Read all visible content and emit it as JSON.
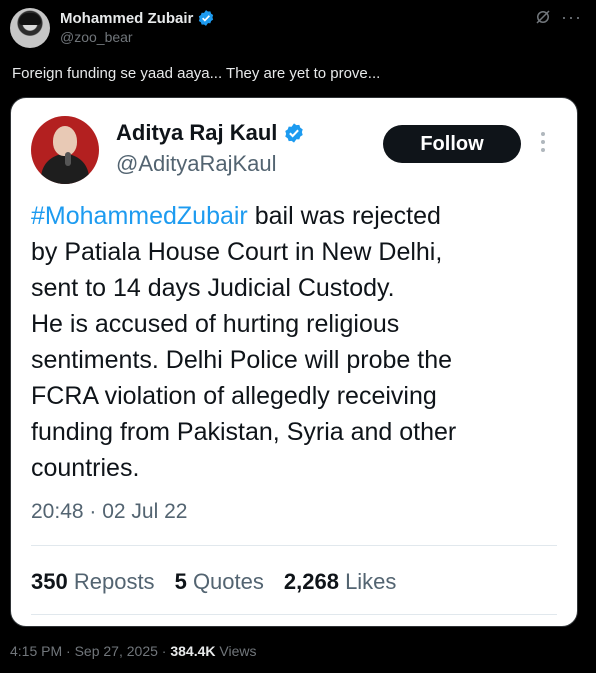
{
  "outer": {
    "author_name": "Mohammed Zubair",
    "author_handle": "@zoo_bear",
    "text": "Foreign funding se yaad aaya... They are yet to prove...",
    "time": "4:15 PM",
    "date": "Sep 27, 2025",
    "separator": "·",
    "views_count": "384.4K",
    "views_label": "Views",
    "more_icon": "···"
  },
  "quote": {
    "author_name": "Aditya Raj Kaul",
    "author_handle": "@AdityaRajKaul",
    "follow_label": "Follow",
    "hashtag": "#MohammedZubair",
    "body_lines": [
      " bail was rejected",
      "by Patiala House Court in New Delhi,",
      "sent to 14 days Judicial Custody.",
      "He is accused of hurting religious",
      "sentiments. Delhi Police will probe the",
      "FCRA violation of allegedly receiving",
      "funding from Pakistan, Syria and other",
      "countries."
    ],
    "timestamp": "20:48 · 02 Jul 22",
    "reposts_count": "350",
    "reposts_label": "Reposts",
    "quotes_count": "5",
    "quotes_label": "Quotes",
    "likes_count": "2,268",
    "likes_label": "Likes"
  },
  "colors": {
    "background": "#000000",
    "card": "#ffffff",
    "accent": "#1d9bf0",
    "follow_button": "#0f1419"
  },
  "icons": {
    "verified": "verified-badge-icon",
    "grok": "grok-icon",
    "more": "more-icon"
  }
}
